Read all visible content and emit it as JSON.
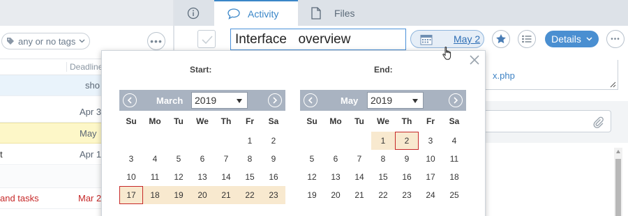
{
  "left": {
    "tag_filter": "any or no tags",
    "column_deadline": "Deadline",
    "rows": [
      {
        "right": "sho",
        "highlight": "#e9f3fb",
        "left": ""
      },
      {
        "right": "Apr 3",
        "highlight": "",
        "left": ""
      },
      {
        "right": "May",
        "highlight": "#fdf7c8",
        "left": ""
      },
      {
        "right": "Apr 1",
        "highlight": "",
        "left": "t"
      },
      {
        "right": "",
        "highlight": "",
        "left": ""
      },
      {
        "right": "Mar 2",
        "highlight": "",
        "left": "and tasks"
      }
    ]
  },
  "tabs": [
    {
      "label": "",
      "icon": "info-icon"
    },
    {
      "label": "Activity",
      "icon": "comment-icon",
      "active": true
    },
    {
      "label": "Files",
      "icon": "file-icon"
    }
  ],
  "task": {
    "title": "Interface  overview",
    "date_label": "May 2",
    "details_label": "Details",
    "desc_link": "x.php"
  },
  "popup": {
    "start_label": "Start:",
    "end_label": "End:",
    "weekdays": [
      "Su",
      "Mo",
      "Tu",
      "We",
      "Th",
      "Fr",
      "Sa"
    ],
    "start": {
      "month": "March",
      "year": "2019",
      "weeks": [
        [
          "",
          "",
          "",
          "",
          "",
          "1",
          "2"
        ],
        [
          "3",
          "4",
          "5",
          "6",
          "7",
          "8",
          "9"
        ],
        [
          "10",
          "11",
          "12",
          "13",
          "14",
          "15",
          "16"
        ],
        [
          "17",
          "18",
          "19",
          "20",
          "21",
          "22",
          "23"
        ]
      ],
      "selected_day": "17",
      "range_from_day": "17"
    },
    "end": {
      "month": "May",
      "year": "2019",
      "weeks": [
        [
          "",
          "",
          "",
          "1",
          "2",
          "3",
          "4"
        ],
        [
          "5",
          "6",
          "7",
          "8",
          "9",
          "10",
          "11"
        ],
        [
          "12",
          "13",
          "14",
          "15",
          "16",
          "17",
          "18"
        ],
        [
          "19",
          "20",
          "21",
          "22",
          "23",
          "24",
          "25"
        ]
      ],
      "selected_day": "2",
      "range_to_day": "2"
    }
  }
}
